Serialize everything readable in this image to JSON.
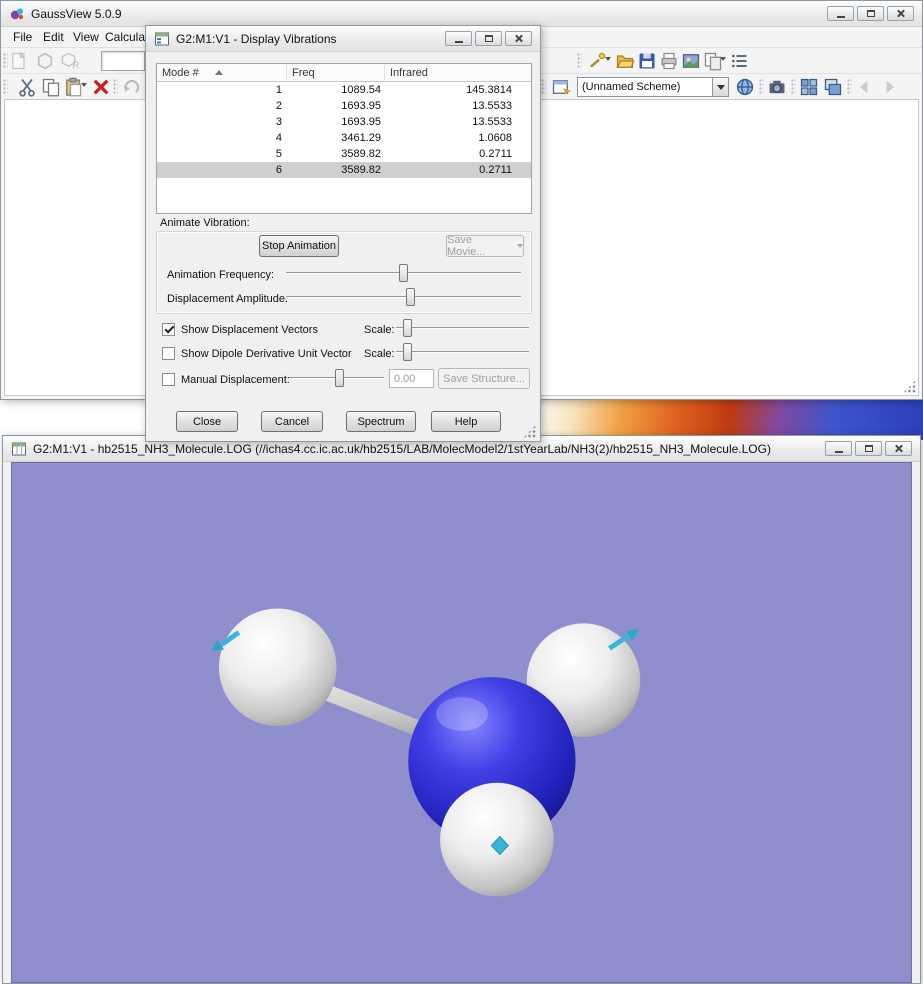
{
  "main": {
    "title": "GaussView 5.0.9",
    "menus": [
      "File",
      "Edit",
      "View",
      "Calculate"
    ],
    "scheme_value": "(Unnamed Scheme)"
  },
  "dialog": {
    "title": "G2:M1:V1 - Display Vibrations",
    "table": {
      "headers": [
        "Mode #",
        "Freq",
        "Infrared"
      ],
      "rows": [
        [
          "1",
          "1089.54",
          "145.3814"
        ],
        [
          "2",
          "1693.95",
          "13.5533"
        ],
        [
          "3",
          "1693.95",
          "13.5533"
        ],
        [
          "4",
          "3461.29",
          "1.0608"
        ],
        [
          "5",
          "3589.82",
          "0.2711"
        ],
        [
          "6",
          "3589.82",
          "0.2711"
        ]
      ],
      "selected_row_index": 5
    },
    "labels": {
      "animate_vibration": "Animate Vibration:",
      "animation_frequency": "Animation Frequency:",
      "displacement_amplitude": "Displacement Amplitude:",
      "show_displacement_vectors": "Show Displacement Vectors",
      "show_dipole_derivative": "Show Dipole Derivative Unit Vector",
      "manual_displacement": "Manual Displacement:",
      "scale": "Scale:"
    },
    "buttons": {
      "stop_animation": "Stop Animation",
      "save_movie": "Save Movie...",
      "save_structure": "Save Structure...",
      "close": "Close",
      "cancel": "Cancel",
      "spectrum": "Spectrum",
      "help": "Help"
    },
    "inputs": {
      "manual_displacement_value": "0.00"
    }
  },
  "molecule_window": {
    "title": "G2:M1:V1 - hb2515_NH3_Molecule.LOG (//ichas4.cc.ic.ac.uk/hb2515/LAB/MolecModel2/1stYearLab/NH3(2)/hb2515_NH3_Molecule.LOG)",
    "molecule": "NH3",
    "background_color": "#8f8fce",
    "nitrogen_color": "#2222c0",
    "hydrogen_color": "#f0f0f0",
    "vector_color": "#38b6da"
  }
}
